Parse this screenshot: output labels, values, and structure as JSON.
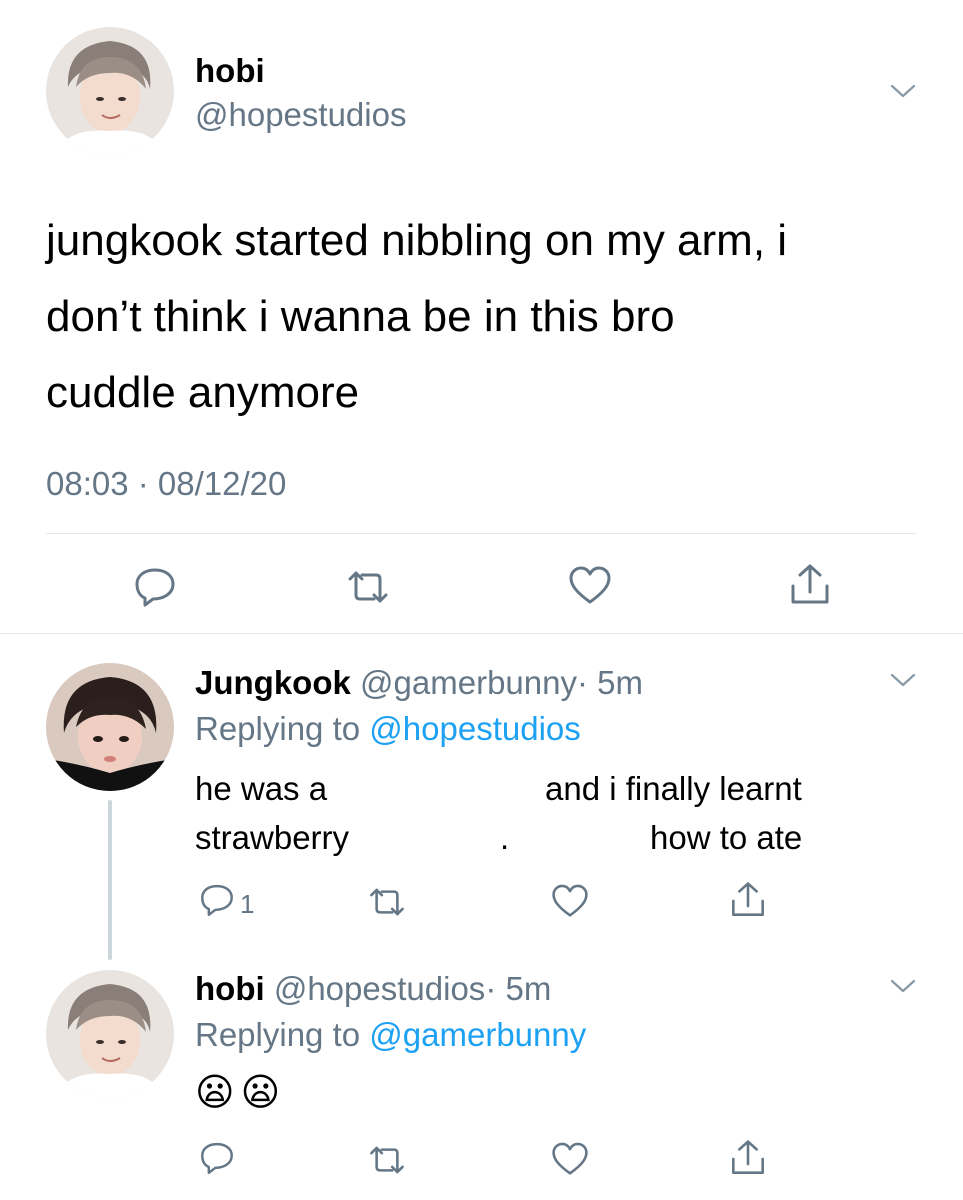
{
  "main_tweet": {
    "display_name": "hobi",
    "handle": "@hopestudios",
    "text_lines": [
      "jungkook started nibbling on my arm, i",
      "don’t think i wanna be in this bro",
      "cuddle anymore"
    ],
    "timestamp": "08:03 · 08/12/20"
  },
  "reply1": {
    "display_name": "Jungkook",
    "handle": "@gamerbunny",
    "time": "· 5m",
    "replying_prefix": "Replying to",
    "replying_handle": "@hopestudios",
    "text": {
      "left_line1": "he was a",
      "left_line2": "strawberry",
      "mid": ".",
      "right_line1": "and i finally learnt",
      "right_line2": "how to ate"
    },
    "reply_count": "1"
  },
  "reply2": {
    "display_name": "hobi",
    "handle": "@hopestudios",
    "time": "· 5m",
    "replying_prefix": "Replying to",
    "replying_handle": "@gamerbunny",
    "emoji": "😦😦"
  },
  "icons": {
    "reply": "reply-icon",
    "retweet": "retweet-icon",
    "like": "heart-icon",
    "share": "share-icon",
    "caret": "chevron-down-icon"
  },
  "colors": {
    "text": "#000000",
    "secondary": "#657786",
    "link": "#1da1f2",
    "divider": "#e1e8ed",
    "thread_line": "#ccd6dd"
  }
}
